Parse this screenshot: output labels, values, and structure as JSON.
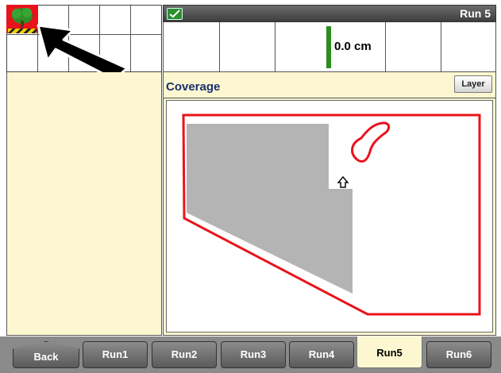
{
  "header": {
    "run_title": "Run 5",
    "status_icon": "check-icon"
  },
  "guidance": {
    "offset_value": "0.0 cm"
  },
  "coverage": {
    "title": "Coverage",
    "layer_button": "Layer"
  },
  "left_panel": {
    "alert_icon": "tree-icon",
    "pointer_icon": "arrow-pointer-icon"
  },
  "colors": {
    "boundary": "#e8131b",
    "coverage_fill": "#b4b4b4",
    "panel_cream": "#fcf7d0",
    "guide_bar": "#2a8d1d"
  },
  "tabs": [
    {
      "label": "Back",
      "active": false
    },
    {
      "label": "Run1",
      "active": false
    },
    {
      "label": "Run2",
      "active": false
    },
    {
      "label": "Run3",
      "active": false
    },
    {
      "label": "Run4",
      "active": false
    },
    {
      "label": "Run5",
      "active": true
    },
    {
      "label": "Run6",
      "active": false
    }
  ]
}
